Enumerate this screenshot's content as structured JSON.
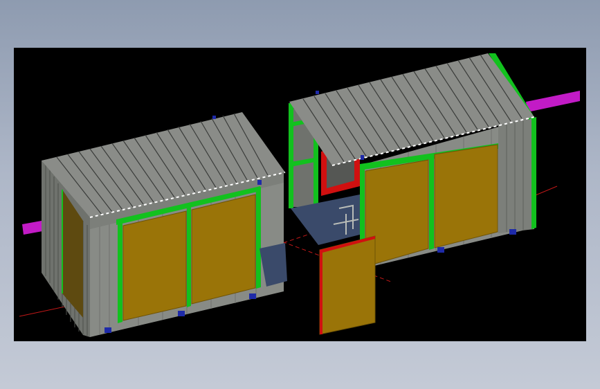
{
  "view": {
    "background_color": "#000000",
    "page_gradient": [
      "#8e9bb0",
      "#c4cad6"
    ]
  },
  "colors": {
    "wall": "#888b86",
    "wall_dark": "#6f726d",
    "roof": "#8a8c88",
    "roof_groove": "#3a3c3a",
    "frame": "#12c11e",
    "panel": "#9a7408",
    "panel_edge": "#6e5306",
    "floor": "#3a4a6a",
    "pipe": "#c21bc6",
    "axis": "#c21818",
    "bracket": "#1e2aa8",
    "door_frame": "#d01010"
  },
  "scene": {
    "objects": [
      "left-container-module",
      "right-container-module",
      "door-panel",
      "pipe",
      "axis-lines"
    ]
  }
}
